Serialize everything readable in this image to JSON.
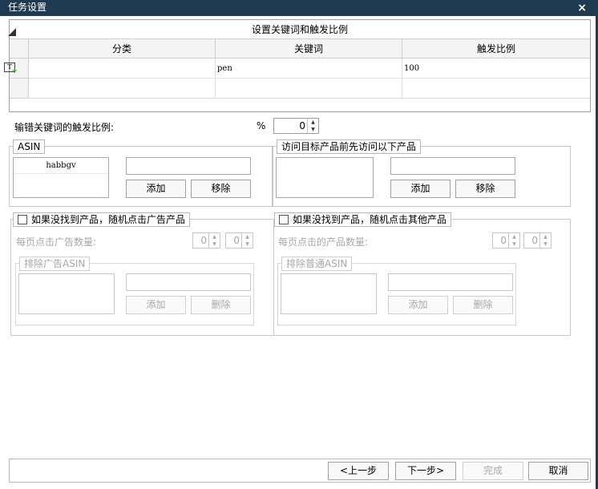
{
  "window": {
    "title": "任务设置",
    "close_icon": "×"
  },
  "keyword_grid": {
    "caption": "设置关键词和触发比例",
    "columns": [
      "分类",
      "关键词",
      "触发比例"
    ],
    "rows": [
      {
        "category": "",
        "keyword": "pen",
        "ratio": "100"
      }
    ],
    "add_row_icon_text": "T"
  },
  "wrong_keyword": {
    "label": "输错关键词的触发比例:",
    "unit": "%",
    "value": "0"
  },
  "asin_group": {
    "legend": "ASIN",
    "items": [
      "habbgv"
    ],
    "input_value": "",
    "add_label": "添加",
    "remove_label": "移除"
  },
  "visit_group": {
    "legend": "访问目标产品前先访问以下产品",
    "items": [],
    "input_value": "",
    "add_label": "添加",
    "remove_label": "移除"
  },
  "ad_group": {
    "checkbox_label": "如果没找到产品，随机点击广告产品",
    "checked": false,
    "count_label": "每页点击广告数量:",
    "min_value": "0",
    "max_value": "0",
    "exclude_legend": "排除广告ASIN",
    "add_label": "添加",
    "delete_label": "删除"
  },
  "other_group": {
    "checkbox_label": "如果没找到产品，随机点击其他产品",
    "checked": false,
    "count_label": "每页点击的产品数量:",
    "min_value": "0",
    "max_value": "0",
    "exclude_legend": "排除普通ASIN",
    "add_label": "添加",
    "delete_label": "删除"
  },
  "footer": {
    "prev_label": "<上一步",
    "next_label": "下一步>",
    "finish_label": "完成",
    "cancel_label": "取消"
  }
}
